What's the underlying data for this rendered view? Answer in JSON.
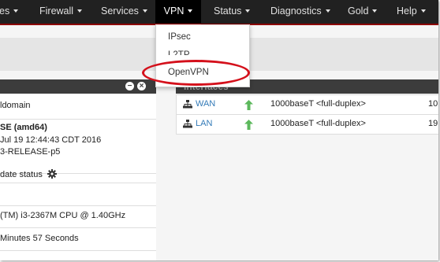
{
  "nav": {
    "items": [
      {
        "label": "Interfaces",
        "partial": "es"
      },
      {
        "label": "Firewall"
      },
      {
        "label": "Services"
      },
      {
        "label": "VPN",
        "active": true
      },
      {
        "label": "Status"
      },
      {
        "label": "Diagnostics"
      },
      {
        "label": "Gold"
      },
      {
        "label": "Help"
      }
    ],
    "active_underline_color": "#b60e0e"
  },
  "vpn_menu": {
    "items": [
      "IPsec",
      "L2TP",
      "OpenVPN"
    ],
    "highlighted": "OpenVPN",
    "highlight_color": "#d4101b"
  },
  "system_info": {
    "header_icons": [
      "minus-circle-icon",
      "close-circle-icon"
    ],
    "hostname": "ldomain",
    "version_line1": "SE (amd64)",
    "version_line2": "Jul 19 12:44:43 CDT 2016",
    "version_line3": "3-RELEASE-p5",
    "update_status": "date status",
    "cpu": "(TM) i3-2367M CPU @ 1.40GHz",
    "uptime": "Minutes 57 Seconds"
  },
  "interfaces": {
    "title": "Interfaces",
    "rows": [
      {
        "name": "WAN",
        "status": "up",
        "media": "1000baseT <full-duplex>",
        "extra": "10"
      },
      {
        "name": "LAN",
        "status": "up",
        "media": "1000baseT <full-duplex>",
        "extra": "19"
      }
    ],
    "status_color": "#5cb85c"
  }
}
